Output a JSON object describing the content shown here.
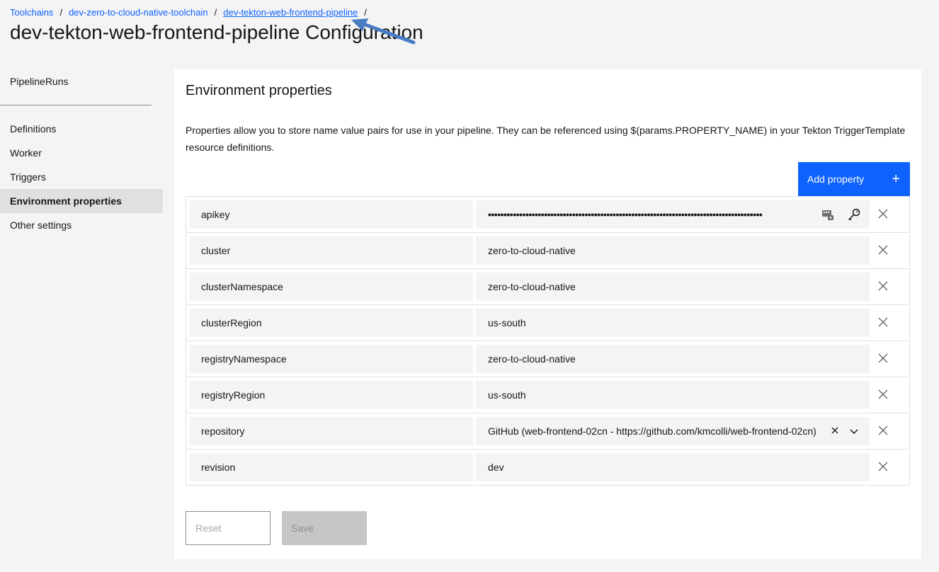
{
  "breadcrumb": {
    "items": [
      "Toolchains",
      "dev-zero-to-cloud-native-toolchain",
      "dev-tekton-web-frontend-pipeline"
    ],
    "separator": "/"
  },
  "page_title": "dev-tekton-web-frontend-pipeline Configuration",
  "sidebar": {
    "top_item": "PipelineRuns",
    "items": [
      {
        "label": "Definitions",
        "active": false
      },
      {
        "label": "Worker",
        "active": false
      },
      {
        "label": "Triggers",
        "active": false
      },
      {
        "label": "Environment properties",
        "active": true
      },
      {
        "label": "Other settings",
        "active": false
      }
    ]
  },
  "main": {
    "section_title": "Environment properties",
    "description": "Properties allow you to store name value pairs for use in your pipeline. They can be referenced using $(params.PROPERTY_NAME) in your Tekton TriggerTemplate resource definitions.",
    "add_button_label": "Add property",
    "add_button_icon": "plus-icon",
    "properties": [
      {
        "name": "apikey",
        "value": "••••••••••••••••••••••••••••••••••••••••••••••••••••••••••••••••••••••••••••••••••••••••",
        "type": "secure"
      },
      {
        "name": "cluster",
        "value": "zero-to-cloud-native",
        "type": "text"
      },
      {
        "name": "clusterNamespace",
        "value": "zero-to-cloud-native",
        "type": "text"
      },
      {
        "name": "clusterRegion",
        "value": "us-south",
        "type": "text"
      },
      {
        "name": "registryNamespace",
        "value": "zero-to-cloud-native",
        "type": "text"
      },
      {
        "name": "registryRegion",
        "value": "us-south",
        "type": "text"
      },
      {
        "name": "repository",
        "value": "GitHub (web-frontend-02cn - https://github.com/kmcolli/web-frontend-02cn)",
        "type": "select"
      },
      {
        "name": "revision",
        "value": "dev",
        "type": "text"
      }
    ],
    "reset_label": "Reset",
    "save_label": "Save"
  },
  "colors": {
    "primary": "#0f62fe",
    "background": "#f4f4f4",
    "annotation_arrow": "#4a7cc4"
  }
}
